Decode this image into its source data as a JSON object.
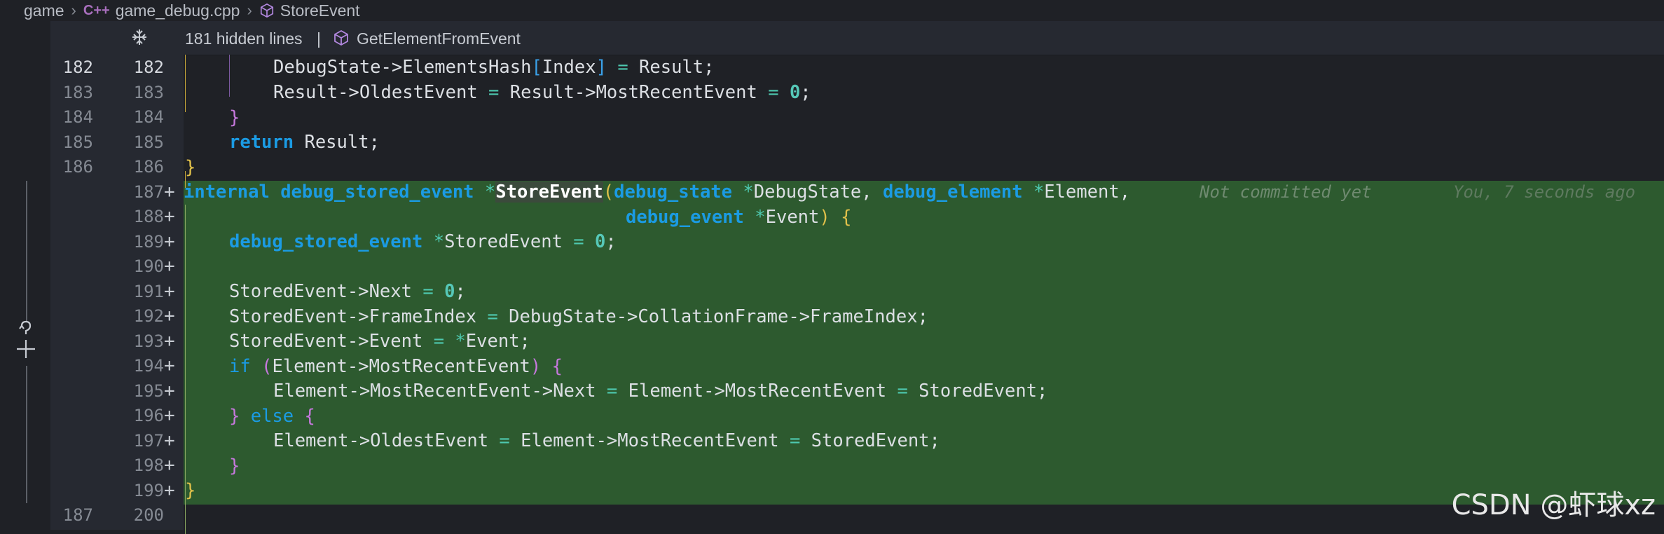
{
  "breadcrumb": {
    "root": "game",
    "file_icon": "C++",
    "file": "game_debug.cpp",
    "symbol": "StoreEvent"
  },
  "sticky": {
    "hidden_lines": "181 hidden lines",
    "separator": "|",
    "function": "GetElementFromEvent"
  },
  "gutter": {
    "base_numbers": [
      "182",
      "183",
      "184",
      "185",
      "186",
      "",
      "",
      "",
      "",
      "",
      "",
      "",
      "",
      "",
      "",
      "",
      "",
      "187"
    ],
    "current_numbers": [
      "182",
      "183",
      "184",
      "185",
      "186",
      "187",
      "188",
      "189",
      "190",
      "191",
      "192",
      "193",
      "194",
      "195",
      "196",
      "197",
      "198",
      "199",
      "200"
    ],
    "added_marker": "+"
  },
  "blame": {
    "status": "Not committed yet",
    "author_time": "You, 7 seconds ago"
  },
  "watermark": "CSDN @虾球xz",
  "colors": {
    "added_background": "#2d5a2f",
    "keyword": "#1b9be3",
    "number": "#56c8b8"
  }
}
